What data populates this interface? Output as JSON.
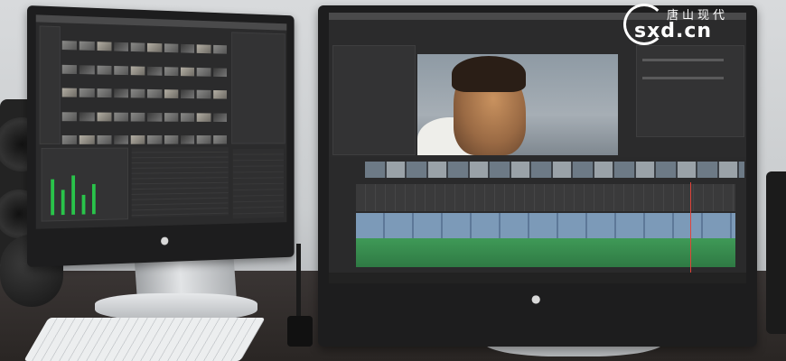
{
  "watermark": {
    "top_text": "唐山现代",
    "main_text": "sxd.cn"
  },
  "colors": {
    "wall": "#cdd0d3",
    "desk": "#2f2a29",
    "ui_dark": "#2b2b2c",
    "audio_meter_green": "#29c44a",
    "video_track_blue": "#7c9ab8",
    "audio_track_green": "#3f9a57",
    "playhead_red": "#e0443a"
  },
  "icons": {
    "apple_logo": "apple-logo-icon"
  }
}
